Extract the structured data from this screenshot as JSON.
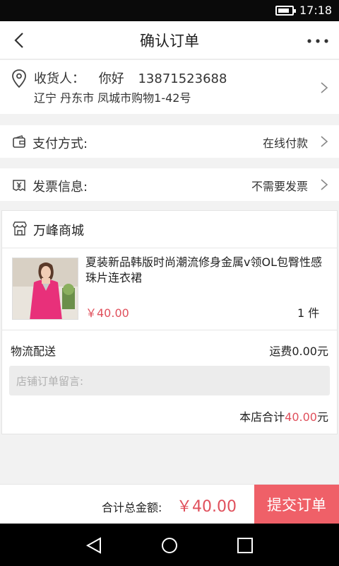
{
  "status_bar": {
    "time": "17:18",
    "battery_level": 0.85,
    "battery_icon": "battery-icon"
  },
  "nav": {
    "title": "确认订单",
    "back_icon": "back-arrow-icon",
    "more_icon": "more-icon"
  },
  "address": {
    "label": "收货人：",
    "name": "你好",
    "phone": "13871523688",
    "detail": "辽宁 丹东市 凤城市购物1-42号",
    "icon": "location-pin-icon"
  },
  "payment": {
    "label": "支付方式:",
    "value": "在线付款",
    "icon": "wallet-icon"
  },
  "invoice": {
    "label": "发票信息:",
    "value": "不需要发票",
    "icon": "invoice-icon"
  },
  "store": {
    "name": "万峰商城",
    "icon": "shop-icon",
    "product": {
      "name": "夏装新品韩版时尚潮流修身金属v领OL包臀性感珠片连衣裙",
      "price": "￥40.00",
      "quantity": "1 件"
    },
    "shipping_label": "物流配送",
    "shipping_fee": "运费0.00元",
    "memo_placeholder": "店铺订单留言:",
    "total_label": "本店合计",
    "total_amount": "40.00",
    "total_unit": "元"
  },
  "footer": {
    "sum_label": "合计总金额:",
    "sum_value": "￥40.00",
    "submit_label": "提交订单"
  },
  "colors": {
    "accent": "#e0505c",
    "submit_bg": "#ef6068"
  }
}
